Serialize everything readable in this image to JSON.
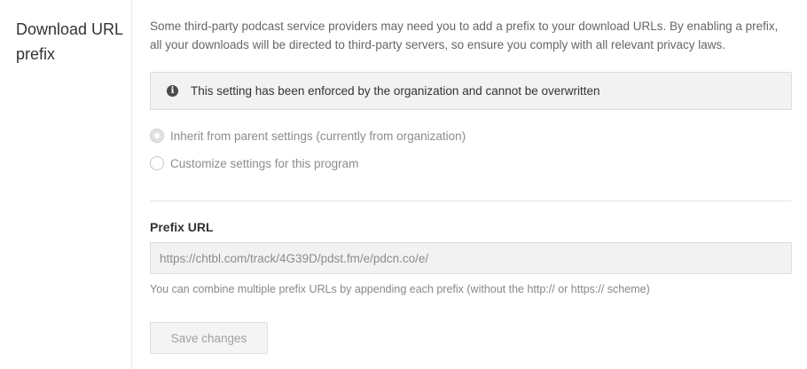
{
  "section": {
    "title": "Download URL prefix"
  },
  "description": "Some third-party podcast service providers may need you to add a prefix to your download URLs. By enabling a prefix, all your downloads will be directed to third-party servers, so ensure you comply with all relevant privacy laws.",
  "notice": {
    "icon": "info-icon",
    "icon_glyph": "i",
    "text": "This setting has been enforced by the organization and cannot be overwritten"
  },
  "options": [
    {
      "label": "Inherit from parent settings (currently from organization)",
      "selected": true
    },
    {
      "label": "Customize settings for this program",
      "selected": false
    }
  ],
  "prefix_field": {
    "label": "Prefix URL",
    "value": "https://chtbl.com/track/4G39D/pdst.fm/e/pdcn.co/e/",
    "help": "You can combine multiple prefix URLs by appending each prefix (without the http:// or https:// scheme)"
  },
  "actions": {
    "save_label": "Save changes"
  }
}
